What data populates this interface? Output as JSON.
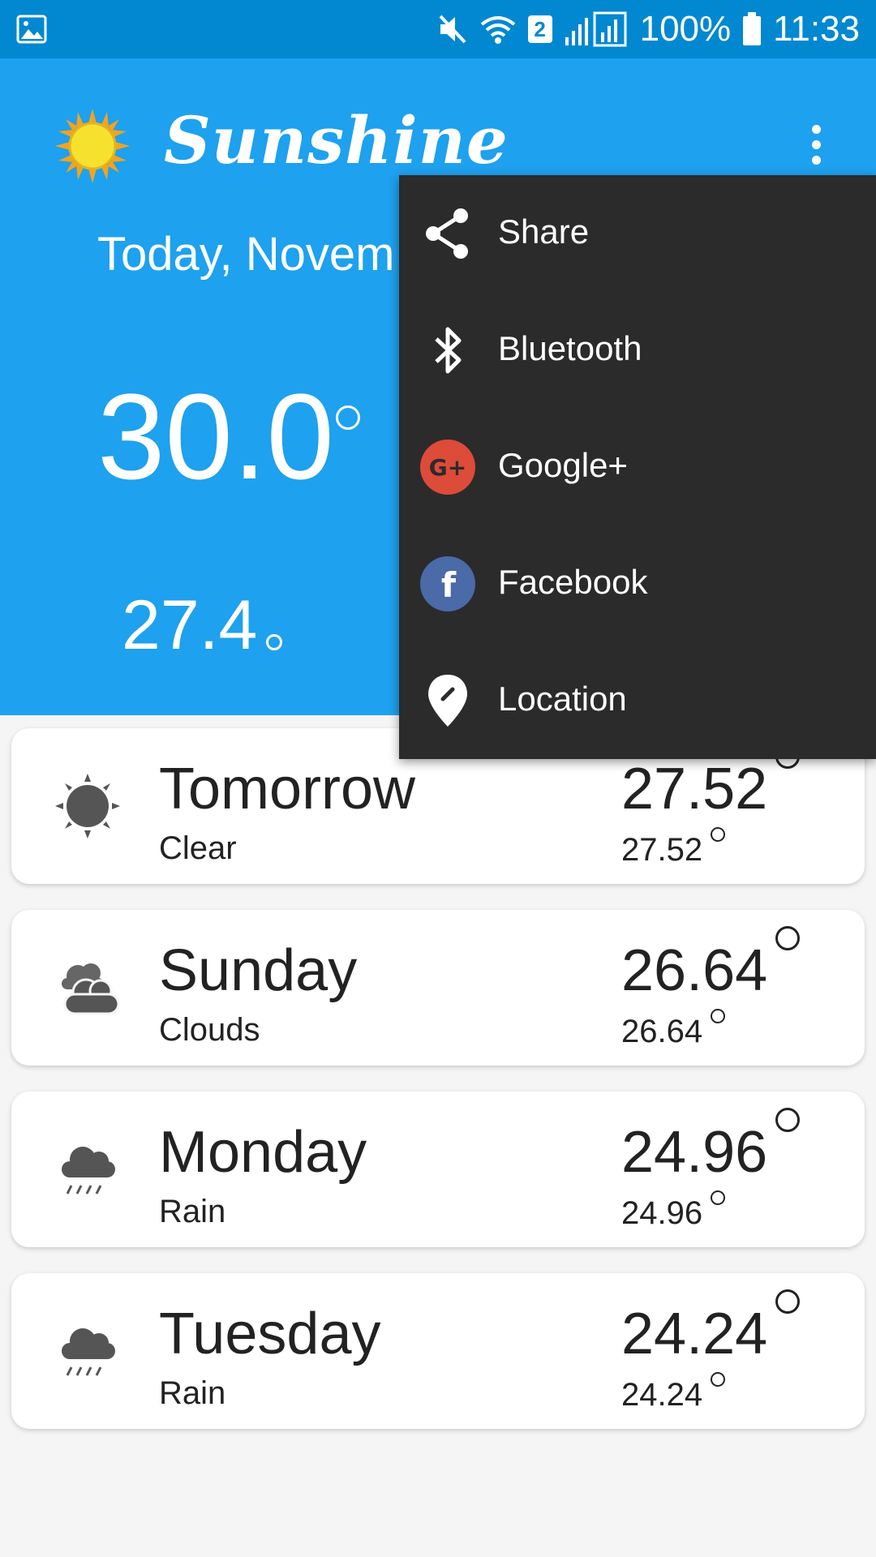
{
  "status_bar": {
    "sim_badge": "2",
    "battery": "100%",
    "time": "11:33"
  },
  "header": {
    "app_title": "Sunshine",
    "date": "Today, Novem",
    "high_temp": "30.0",
    "low_temp": "27.4"
  },
  "forecast": [
    {
      "day": "Tomorrow",
      "desc": "Clear",
      "high": "27.52",
      "low": "27.52",
      "icon": "sun-icon"
    },
    {
      "day": "Sunday",
      "desc": "Clouds",
      "high": "26.64",
      "low": "26.64",
      "icon": "clouds-icon"
    },
    {
      "day": "Monday",
      "desc": "Rain",
      "high": "24.96",
      "low": "24.96",
      "icon": "rain-icon"
    },
    {
      "day": "Tuesday",
      "desc": "Rain",
      "high": "24.24",
      "low": "24.24",
      "icon": "rain-icon"
    }
  ],
  "menu": {
    "items": [
      {
        "label": "Share",
        "icon": "share-icon"
      },
      {
        "label": "Bluetooth",
        "icon": "bluetooth-icon"
      },
      {
        "label": "Google+",
        "icon": "google-plus-icon"
      },
      {
        "label": "Facebook",
        "icon": "facebook-icon"
      },
      {
        "label": "Location",
        "icon": "location-pin-icon"
      }
    ]
  },
  "colors": {
    "status_bar": "#0288d1",
    "header": "#1ea1ee",
    "menu_bg": "#2b2b2b",
    "google_plus": "#dd4b39",
    "facebook": "#3b5998"
  }
}
